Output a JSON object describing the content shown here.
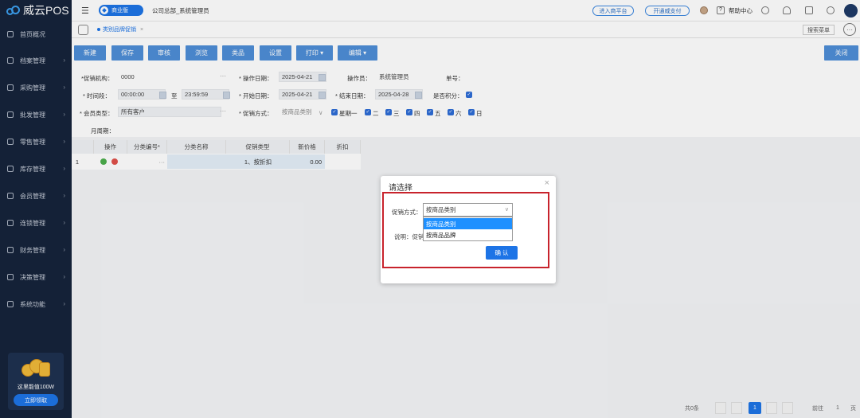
{
  "app": {
    "name": "威云POS"
  },
  "sidebar": {
    "items": [
      {
        "label": "首页概况",
        "icon": "home-icon"
      },
      {
        "label": "档案管理",
        "icon": "folder-icon"
      },
      {
        "label": "采购管理",
        "icon": "cart-icon"
      },
      {
        "label": "批发管理",
        "icon": "building-icon"
      },
      {
        "label": "零售管理",
        "icon": "store-icon"
      },
      {
        "label": "库存管理",
        "icon": "inventory-icon"
      },
      {
        "label": "会员管理",
        "icon": "gift-icon"
      },
      {
        "label": "连锁管理",
        "icon": "chain-icon"
      },
      {
        "label": "财务管理",
        "icon": "finance-icon"
      },
      {
        "label": "决策管理",
        "icon": "chart-icon"
      },
      {
        "label": "系统功能",
        "icon": "gear-icon"
      }
    ],
    "promo": {
      "text": "这里能值100W",
      "button": "立即领取"
    }
  },
  "topbar": {
    "edition": "商业版",
    "company": "公司总部_系统管理员",
    "link1": "进入商平台",
    "link2": "开通威支付",
    "help": "帮助中心"
  },
  "tabs": {
    "active": "类别品牌促销",
    "close": "×",
    "menu_search": "搜索菜单",
    "more": "···"
  },
  "toolbar": {
    "new": "新建",
    "save": "保存",
    "audit": "审核",
    "preview": "浏览",
    "products": "类品",
    "settings": "设置",
    "print": "打印 ▾",
    "edit": "编辑 ▾",
    "close": "关闭"
  },
  "form": {
    "org_label": "*促销机构：",
    "org_value": "0000",
    "op_date_label": "* 操作日期：",
    "op_date": "2025-04-21",
    "operator_label": "操作员：",
    "operator": "系统管理员",
    "order_no_label": "单号：",
    "time_label": "* 时间段：",
    "time_start": "00:00:00",
    "time_to": "至",
    "time_end": "23:59:59",
    "start_date_label": "* 开始日期：",
    "start_date": "2025-04-21",
    "end_date_label": "* 结束日期：",
    "end_date": "2025-04-28",
    "points_label": "是否积分：",
    "member_label": "* 会员类型：",
    "member_value": "所有客户",
    "method_label": "* 促销方式：",
    "method_value": "按商品类别",
    "weekdays": [
      "星期一",
      "二",
      "三",
      "四",
      "五",
      "六",
      "日"
    ],
    "monthly_label": "月周期："
  },
  "grid": {
    "headers": [
      "操作",
      "分类编号*",
      "分类名称",
      "促销类型",
      "新价格",
      "折扣"
    ],
    "row": {
      "index": "1",
      "type": "1、按折扣",
      "price": "0.00",
      "dots": "···"
    }
  },
  "dialog": {
    "title": "请选择",
    "close": "×",
    "mode_label": "促销方式：",
    "mode_selected": "按商品类别",
    "options": [
      "按商品类别",
      "按商品品牌"
    ],
    "desc_label": "说明：促销",
    "ok": "确 认"
  },
  "pager": {
    "total": "共0条",
    "current": "1",
    "page_label": "前往",
    "page_value": "1",
    "page_unit": "页"
  },
  "colors": {
    "sidebar": "#16243b",
    "primary": "#1d74e6",
    "toolbar_btn": "#4e8ed7",
    "highlight": "#c8232c"
  }
}
